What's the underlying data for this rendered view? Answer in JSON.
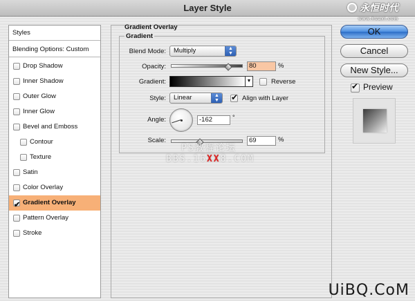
{
  "window": {
    "title": "Layer Style"
  },
  "watermark_top": {
    "main": "永恒时代",
    "sub": "www.huaxi.com"
  },
  "left_panel": {
    "items": [
      {
        "label": "Styles",
        "type": "header"
      },
      {
        "label": "Blending Options: Custom",
        "type": "header"
      },
      {
        "label": "Drop Shadow",
        "checked": false
      },
      {
        "label": "Inner Shadow",
        "checked": false
      },
      {
        "label": "Outer Glow",
        "checked": false
      },
      {
        "label": "Inner Glow",
        "checked": false
      },
      {
        "label": "Bevel and Emboss",
        "checked": false
      },
      {
        "label": "Contour",
        "checked": false
      },
      {
        "label": "Texture",
        "checked": false
      },
      {
        "label": "Satin",
        "checked": false
      },
      {
        "label": "Color Overlay",
        "checked": false
      },
      {
        "label": "Gradient Overlay",
        "checked": true,
        "selected": true
      },
      {
        "label": "Pattern Overlay",
        "checked": false
      },
      {
        "label": "Stroke",
        "checked": false
      }
    ]
  },
  "gradient_overlay": {
    "section_title": "Gradient Overlay",
    "group_title": "Gradient",
    "blend_mode": {
      "label": "Blend Mode:",
      "value": "Multiply"
    },
    "opacity": {
      "label": "Opacity:",
      "value": "80",
      "unit": "%",
      "fraction": 0.8
    },
    "gradient": {
      "label": "Gradient:"
    },
    "reverse": {
      "label": "Reverse",
      "checked": false
    },
    "style": {
      "label": "Style:",
      "value": "Linear"
    },
    "align_with_layer": {
      "label": "Align with Layer",
      "checked": true
    },
    "angle": {
      "label": "Angle:",
      "value": "-162",
      "unit": "°"
    },
    "scale": {
      "label": "Scale:",
      "value": "69",
      "unit": "%",
      "fraction": 0.69
    }
  },
  "buttons": {
    "ok": "OK",
    "cancel": "Cancel",
    "new_style": "New Style...",
    "preview": {
      "label": "Preview",
      "checked": true
    }
  },
  "watermarks": {
    "ps_forum": "PS教程论坛",
    "bbs": "BBS.16",
    "bbs_xx": "XX",
    "bbs_tail": "8.COM",
    "corner": "UiBQ.CoM"
  },
  "colors": {
    "selected_row": "#f7b077",
    "accent_button": "#4d8fe0",
    "opacity_field_bg": "#f9c7a4"
  }
}
